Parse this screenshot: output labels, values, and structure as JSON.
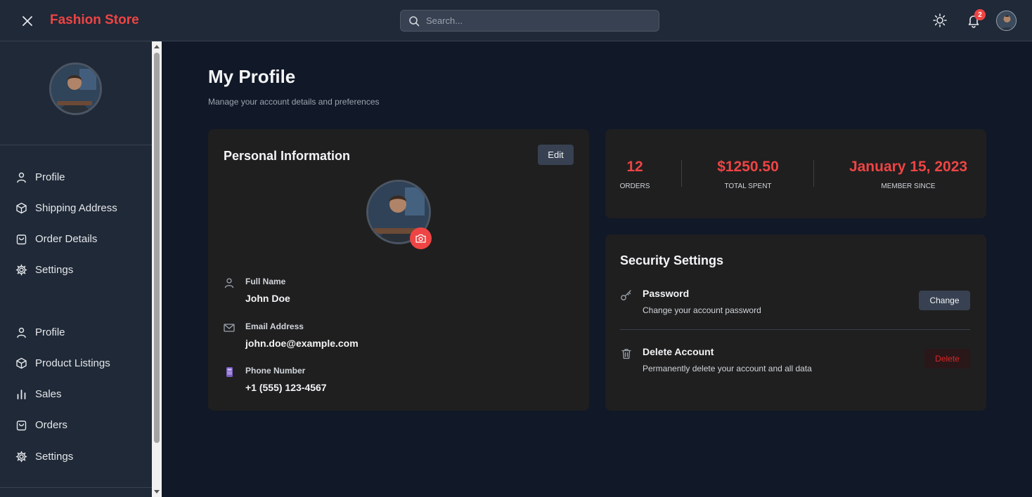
{
  "header": {
    "brand": "Fashion Store",
    "search_placeholder": "Search...",
    "notification_count": "2"
  },
  "sidebar": {
    "group1": [
      {
        "label": "Profile",
        "icon": "user-icon"
      },
      {
        "label": "Shipping Address",
        "icon": "box-icon"
      },
      {
        "label": "Order Details",
        "icon": "bag-icon"
      },
      {
        "label": "Settings",
        "icon": "gear-icon"
      }
    ],
    "group2": [
      {
        "label": "Profile",
        "icon": "user-icon"
      },
      {
        "label": "Product Listings",
        "icon": "box-icon"
      },
      {
        "label": "Sales",
        "icon": "bar-chart-icon"
      },
      {
        "label": "Orders",
        "icon": "bag-icon"
      },
      {
        "label": "Settings",
        "icon": "gear-icon"
      }
    ]
  },
  "page": {
    "title": "My Profile",
    "subtitle": "Manage your account details and preferences"
  },
  "personal": {
    "title": "Personal Information",
    "edit_label": "Edit",
    "fields": [
      {
        "label": "Full Name",
        "value": "John Doe",
        "icon": "user-icon"
      },
      {
        "label": "Email Address",
        "value": "john.doe@example.com",
        "icon": "mail-icon"
      },
      {
        "label": "Phone Number",
        "value": "+1 (555) 123-4567",
        "icon": "phone-icon"
      }
    ]
  },
  "stats": [
    {
      "value": "12",
      "label": "Orders"
    },
    {
      "value": "$1250.50",
      "label": "Total Spent"
    },
    {
      "value": "January 15, 2023",
      "label": "Member Since"
    }
  ],
  "security": {
    "title": "Security Settings",
    "password": {
      "title": "Password",
      "desc": "Change your account password",
      "button": "Change"
    },
    "delete": {
      "title": "Delete Account",
      "desc": "Permanently delete your account and all data",
      "button": "Delete"
    }
  },
  "colors": {
    "accent": "#ef4444",
    "background": "#111827",
    "card": "#1f1f1f",
    "header": "#1f2937"
  }
}
